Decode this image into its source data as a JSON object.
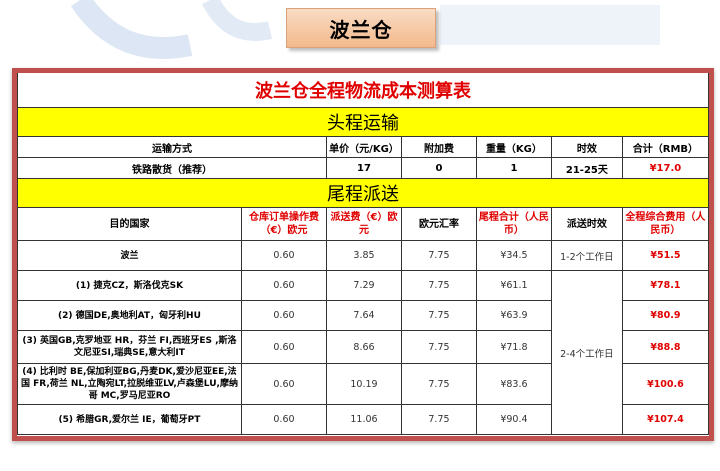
{
  "page_title": "波兰仓",
  "table": {
    "title": "波兰仓全程物流成本测算表",
    "section_head": "头程运输",
    "head_columns": [
      "运输方式",
      "单价（元/KG）",
      "附加费",
      "重量（KG）",
      "时效",
      "合计（RMB）"
    ],
    "head_row": {
      "method": "铁路散货（推荐）",
      "unit_price": "17",
      "surcharge": "0",
      "weight": "1",
      "transit": "21-25天",
      "total": "¥17.0"
    },
    "section_tail": "尾程派送",
    "tail_columns": {
      "dest": "目的国家",
      "op_fee": "仓库订单操作费（€）欧元",
      "delivery_fee": "派送费（€）欧元",
      "rate": "欧元汇率",
      "tail_total": "尾程合计（人民币）",
      "transit": "派送时效",
      "grand_total": "全程综合费用（人民币）"
    },
    "tail_rows": [
      {
        "dest": "波兰",
        "op_fee": "0.60",
        "delivery_fee": "3.85",
        "rate": "7.75",
        "tail_total": "¥34.5",
        "transit": "1-2个工作日",
        "grand_total": "¥51.5"
      },
      {
        "dest": "(1) 捷克CZ，斯洛伐克SK",
        "op_fee": "0.60",
        "delivery_fee": "7.29",
        "rate": "7.75",
        "tail_total": "¥61.1",
        "grand_total": "¥78.1"
      },
      {
        "dest": "(2) 德国DE,奥地利AT，匈牙利HU",
        "op_fee": "0.60",
        "delivery_fee": "7.64",
        "rate": "7.75",
        "tail_total": "¥63.9",
        "grand_total": "¥80.9"
      },
      {
        "dest": "(3) 英国GB,克罗地亚 HR，芬兰 FI,西班牙ES ,斯洛文尼亚SI,瑞典SE,意大利IT",
        "op_fee": "0.60",
        "delivery_fee": "8.66",
        "rate": "7.75",
        "tail_total": "¥71.8",
        "grand_total": "¥88.8"
      },
      {
        "dest": "(4) 比利时 BE,保加利亚BG,丹麦DK,爱沙尼亚EE,法国 FR,荷兰 NL,立陶宛LT,拉脱维亚LV,卢森堡LU,摩纳哥 MC,罗马尼亚RO",
        "op_fee": "0.60",
        "delivery_fee": "10.19",
        "rate": "7.75",
        "tail_total": "¥83.6",
        "grand_total": "¥100.6"
      },
      {
        "dest": "(5) 希腊GR,爱尔兰 IE，葡萄牙PT",
        "op_fee": "0.60",
        "delivery_fee": "11.06",
        "rate": "7.75",
        "tail_total": "¥90.4",
        "grand_total": "¥107.4"
      }
    ],
    "merged_transit": "2-4个工作日"
  }
}
